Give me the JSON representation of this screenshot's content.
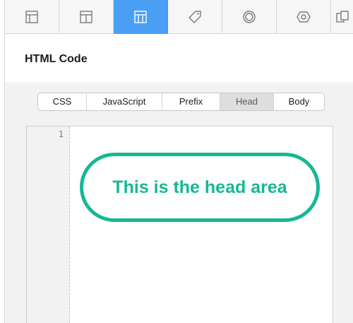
{
  "toolbar": {
    "tools": [
      {
        "name": "layout-panel-icon",
        "active": false
      },
      {
        "name": "layout-panel-alt-icon",
        "active": false
      },
      {
        "name": "html-code-icon",
        "active": true
      },
      {
        "name": "tag-icon",
        "active": false
      },
      {
        "name": "circle-target-icon",
        "active": false
      },
      {
        "name": "hexagon-icon",
        "active": false
      },
      {
        "name": "more-panel-icon",
        "active": false
      }
    ]
  },
  "header": {
    "title": "HTML Code"
  },
  "tabs": {
    "items": [
      "CSS",
      "JavaScript",
      "Prefix",
      "Head",
      "Body"
    ],
    "active": "Head"
  },
  "editor": {
    "line_number": "1"
  },
  "callout": {
    "text": "This is the head area"
  },
  "colors": {
    "accent": "#4a9ff5",
    "callout": "#16b795"
  }
}
